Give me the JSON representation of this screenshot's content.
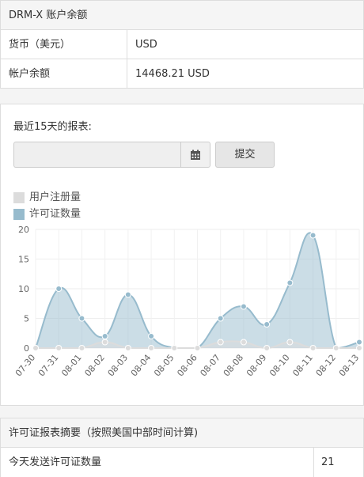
{
  "balance": {
    "title": "DRM-X 账户余额",
    "currency_label": "货币（美元）",
    "currency_value": "USD",
    "balance_label": "帐户余额",
    "balance_value": "14468.21 USD"
  },
  "report": {
    "label": "最近15天的报表:",
    "date_value": "",
    "submit_label": "提交",
    "legend": [
      {
        "name": "用户注册量",
        "color": "#dcdcdc"
      },
      {
        "name": "许可证数量",
        "color": "#97bbcd"
      }
    ]
  },
  "chart_data": {
    "type": "area",
    "categories": [
      "07-30",
      "07-31",
      "08-01",
      "08-02",
      "08-03",
      "08-04",
      "08-05",
      "08-06",
      "08-07",
      "08-08",
      "08-09",
      "08-10",
      "08-11",
      "08-12",
      "08-13"
    ],
    "series": [
      {
        "name": "用户注册量",
        "color": "#dcdcdc",
        "values": [
          0,
          0,
          0,
          1,
          0,
          0,
          0,
          0,
          1,
          1,
          0,
          1,
          0,
          0,
          0
        ]
      },
      {
        "name": "许可证数量",
        "color": "#97bbcd",
        "values": [
          0,
          10,
          5,
          2,
          9,
          2,
          0,
          0,
          5,
          7,
          4,
          11,
          19,
          0,
          1
        ]
      }
    ],
    "yticks": [
      0,
      5,
      10,
      15,
      20
    ],
    "ylim": [
      0,
      20
    ],
    "grid": true
  },
  "summary": {
    "title": "许可证报表摘要（按照美国中部时间计算)",
    "today_label": "今天发送许可证数量",
    "today_value": "21"
  }
}
